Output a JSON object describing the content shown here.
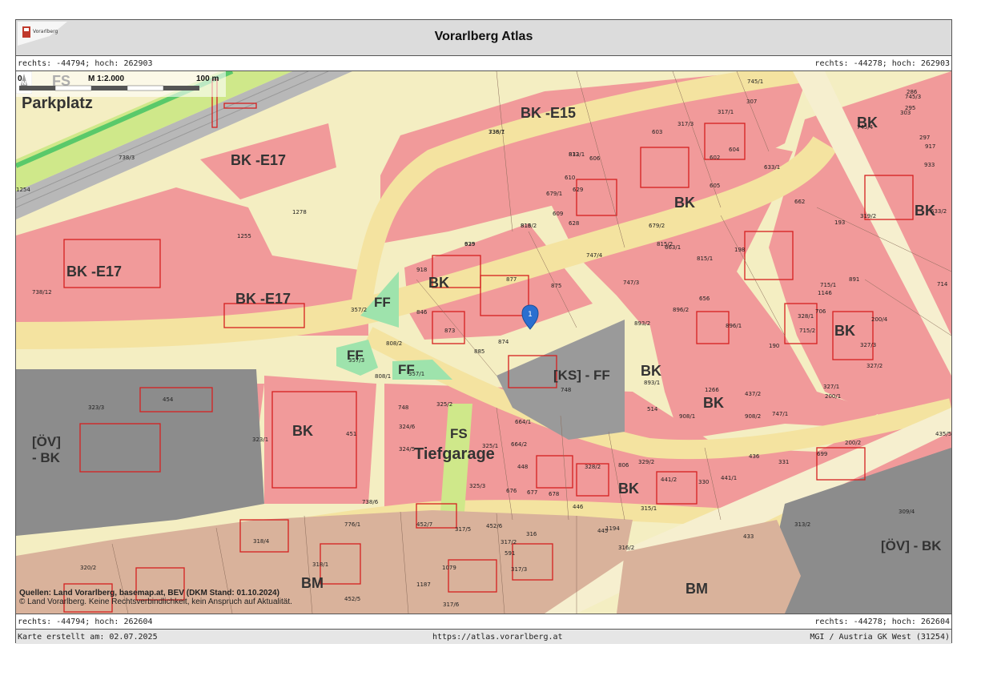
{
  "header": {
    "title": "Vorarlberg Atlas",
    "logo_text": "Vorarlberg"
  },
  "coords": {
    "top_left": "rechts: -44794; hoch: 262903",
    "top_right": "rechts: -44278; hoch: 262903",
    "bottom_left": "rechts: -44794; hoch: 262604",
    "bottom_right": "rechts: -44278; hoch: 262604"
  },
  "footer": {
    "created": "Karte erstellt am: 02.07.2025",
    "url": "https://atlas.vorarlberg.at",
    "projection": "MGI / Austria GK West (31254)"
  },
  "map": {
    "sources_line1": "Quellen: Land Vorarlberg, basemap.at, BEV (DKM Stand: 01.10.2024)",
    "sources_line2": "© Land Vorarlberg. Keine Rechtsverbindlichkeit, kein Anspruch auf Aktualität.",
    "scale_label": "M 1:2.000",
    "scale_start": "0",
    "scale_end": "100 m",
    "north_label": "N",
    "marker_label": "1",
    "colors": {
      "bk": "#f19a9a",
      "bm": "#d9b29b",
      "road": "#f4e3a0",
      "ff": "#9ee3ac",
      "ks": "#9a9a9a",
      "ov": "#8c8c8c",
      "fs": "#cfe88a",
      "rail": "#b8b8b8",
      "border": "#d52020"
    },
    "zones": [
      {
        "label": "FS",
        "kind": "fs"
      },
      {
        "label": "Parkplatz",
        "kind": "fs"
      },
      {
        "label": "BK -E15",
        "kind": "bk"
      },
      {
        "label": "BK -E17",
        "kind": "bk"
      },
      {
        "label": "BK -E17",
        "kind": "bk"
      },
      {
        "label": "BK -E17",
        "kind": "bk"
      },
      {
        "label": "BK",
        "kind": "bk"
      },
      {
        "label": "BK",
        "kind": "bk"
      },
      {
        "label": "BK",
        "kind": "bk"
      },
      {
        "label": "BK",
        "kind": "bk"
      },
      {
        "label": "BK",
        "kind": "bk"
      },
      {
        "label": "BK",
        "kind": "bk"
      },
      {
        "label": "BK",
        "kind": "bk"
      },
      {
        "label": "BK",
        "kind": "bk"
      },
      {
        "label": "BK",
        "kind": "bk"
      },
      {
        "label": "FF",
        "kind": "ff"
      },
      {
        "label": "FF",
        "kind": "ff"
      },
      {
        "label": "FF",
        "kind": "ff"
      },
      {
        "label": "[KS] - FF",
        "kind": "ks"
      },
      {
        "label": "FS",
        "kind": "fs"
      },
      {
        "label": "Tiefgarage",
        "kind": "fs"
      },
      {
        "label": "[ÖV]",
        "kind": "ov"
      },
      {
        "label": "- BK",
        "kind": "ov"
      },
      {
        "label": "[ÖV] - BK",
        "kind": "ov"
      },
      {
        "label": "BM",
        "kind": "bm"
      },
      {
        "label": "BM",
        "kind": "bm"
      }
    ],
    "parcels": [
      "738/7",
      "832",
      "816",
      "939",
      "918",
      "877",
      "875",
      "846",
      "873",
      "874",
      "885",
      "808/2",
      "808/1",
      "357/2",
      "357/3",
      "357/1",
      "1278",
      "738/12",
      "738/3",
      "454",
      "323/3",
      "323/1",
      "451",
      "748",
      "325/2",
      "324/6",
      "324/5",
      "664/1",
      "664/2",
      "325/1",
      "448",
      "325/3",
      "676",
      "677",
      "678",
      "446",
      "328/2",
      "806",
      "329/2",
      "441/2",
      "330",
      "441/1",
      "315/1",
      "436",
      "331",
      "699",
      "200/2",
      "435/5",
      "309/4",
      "433",
      "313/2",
      "1194",
      "316/2",
      "445",
      "316",
      "591",
      "317/3",
      "317/2",
      "452/6",
      "1079",
      "317/5",
      "452/7",
      "318/4",
      "318/1",
      "320/2",
      "1187",
      "317/6",
      "452/5",
      "893/2",
      "893/1",
      "514",
      "908/1",
      "1266",
      "437/2",
      "908/2",
      "747/1",
      "327/1",
      "200/1",
      "327/2",
      "327/3",
      "200/4",
      "328/1",
      "715/2",
      "706",
      "1146",
      "715/1",
      "891",
      "714",
      "198",
      "662",
      "633/1",
      "193",
      "319/2",
      "633/2",
      "933",
      "917",
      "297",
      "295",
      "286",
      "303",
      "745/3",
      "745/4",
      "745/1",
      "307",
      "317/3",
      "317/1",
      "604",
      "603",
      "602",
      "605",
      "606",
      "610",
      "629",
      "628",
      "609",
      "679/1",
      "679/2",
      "663/1",
      "815/2",
      "815/1",
      "747/4",
      "747/3",
      "656",
      "896/1",
      "896/2",
      "1255",
      "1254",
      "748",
      "776/1",
      "738/6",
      "190",
      "336/1",
      "813/1",
      "813/2",
      "625"
    ]
  }
}
